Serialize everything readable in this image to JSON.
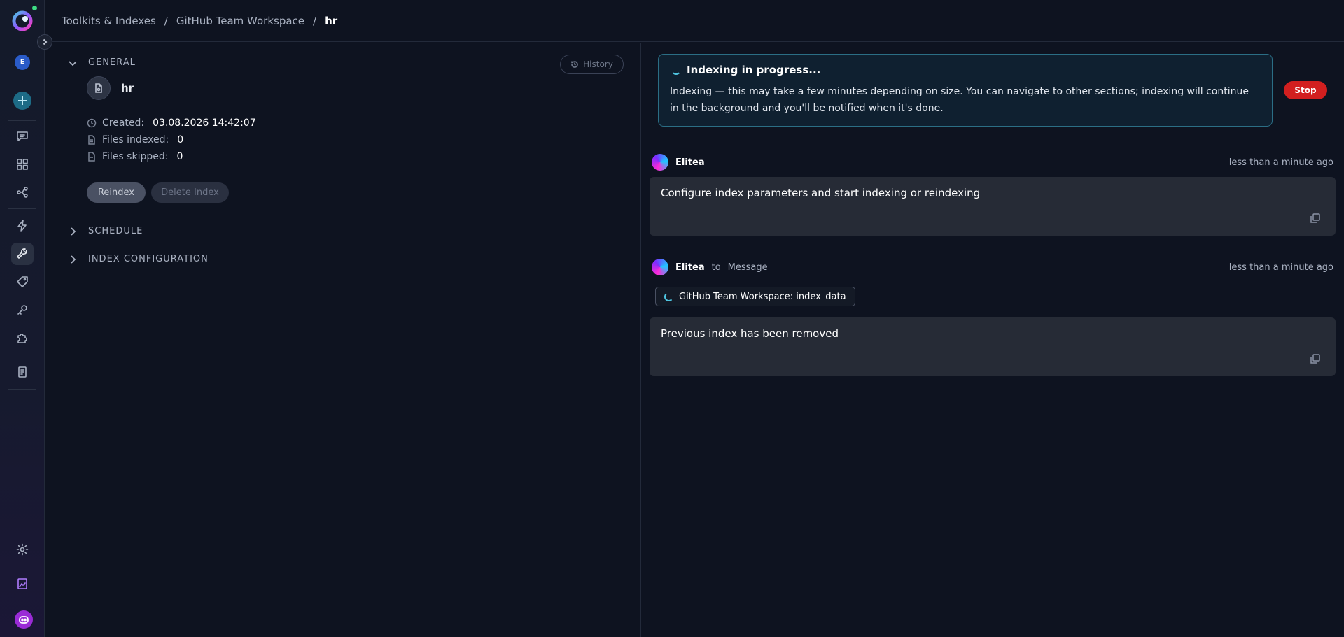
{
  "breadcrumb": {
    "item1": "Toolkits & Indexes",
    "item2": "GitHub Team Workspace",
    "current": "hr",
    "separator": "/"
  },
  "sidebar": {
    "user_initial": "E",
    "icons": [
      "logo-icon",
      "chevron-right-icon",
      "plus-icon",
      "chat-icon",
      "grid-icon",
      "flow-icon",
      "bolt-icon",
      "wrench-icon",
      "tag-icon",
      "key-icon",
      "puzzle-icon",
      "document-icon",
      "settings-icon",
      "image-icon",
      "bot-icon"
    ],
    "status_color": "#3ddc84"
  },
  "general": {
    "section_label": "GENERAL",
    "history_label": "History",
    "index_name": "hr",
    "created_label": "Created:",
    "created_value": "03.08.2026 14:42:07",
    "files_indexed_label": "Files indexed:",
    "files_indexed_value": "0",
    "files_skipped_label": "Files skipped:",
    "files_skipped_value": "0",
    "reindex_label": "Reindex",
    "delete_label": "Delete Index"
  },
  "schedule": {
    "section_label": "SCHEDULE"
  },
  "index_configuration": {
    "section_label": "INDEX CONFIGURATION"
  },
  "progress": {
    "title": "Indexing in progress...",
    "text": "Indexing — this may take a few minutes depending on size. You can navigate to other sections; indexing will continue in the background and you'll be notified when it's done.",
    "stop_label": "Stop",
    "stop_color": "#d21f1f"
  },
  "messages": [
    {
      "author": "Elitea",
      "time": "less than a minute ago",
      "text": "Configure index parameters and start indexing or reindexing"
    },
    {
      "author": "Elitea",
      "to_label": "to",
      "to_target": "Message",
      "time": "less than a minute ago",
      "tool_chip": "GitHub Team Workspace: index_data",
      "text": "Previous index has been removed"
    }
  ]
}
